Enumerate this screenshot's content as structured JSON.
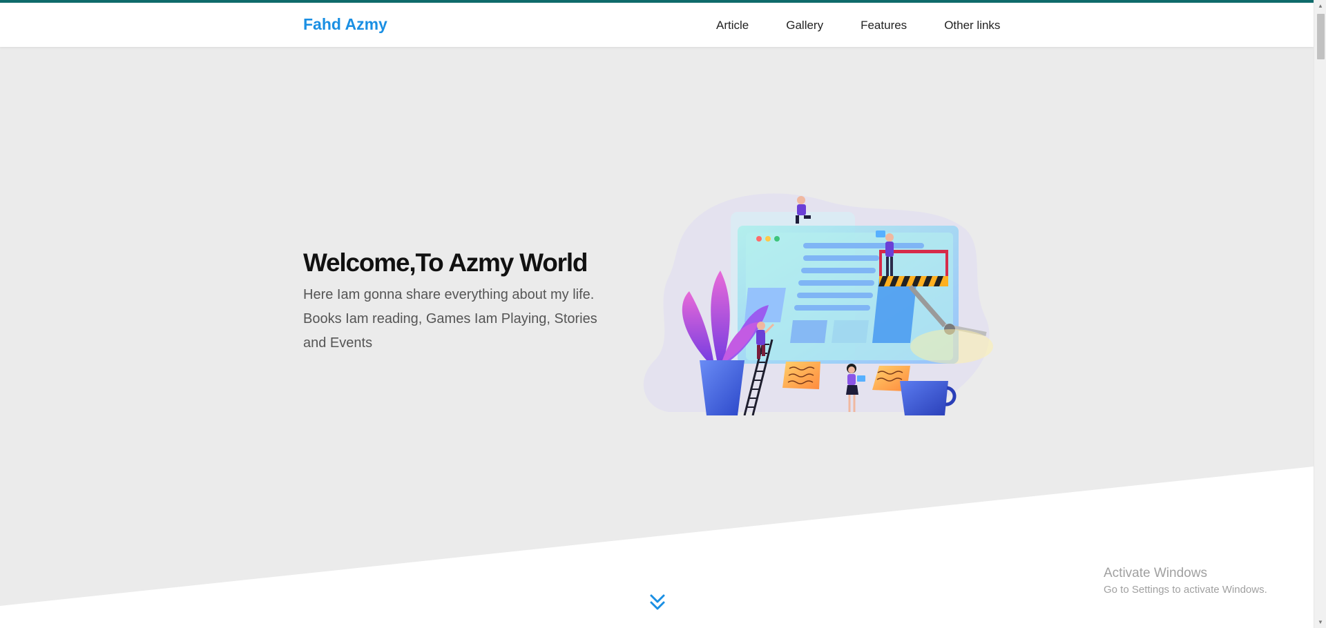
{
  "navbar": {
    "brand": "Fahd Azmy",
    "links": [
      "Article",
      "Gallery",
      "Features",
      "Other links"
    ]
  },
  "hero": {
    "title": "Welcome,To Azmy World",
    "subtitle": "Here Iam gonna share everything about my life. Books Iam reading, Games Iam Playing, Stories and Events"
  },
  "scroll_icon": "double-chevron-down-icon",
  "watermark": {
    "title": "Activate Windows",
    "subtitle": "Go to Settings to activate Windows."
  },
  "colors": {
    "accent": "#1a8fe3",
    "top_strip": "#0f6b6b",
    "hero_bg": "#ebebeb"
  }
}
